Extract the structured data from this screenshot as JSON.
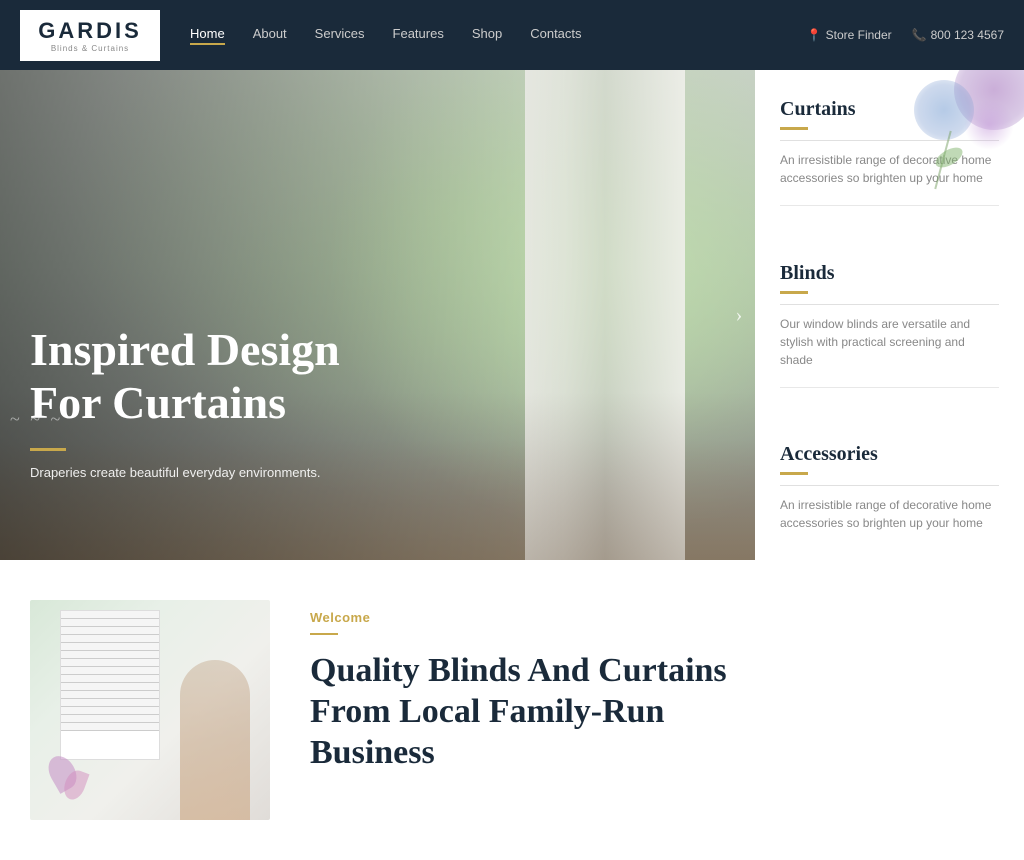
{
  "brand": {
    "name": "GARDIS",
    "subtitle": "Blinds & Curtains"
  },
  "navbar": {
    "links": [
      {
        "label": "Home",
        "active": true
      },
      {
        "label": "About",
        "active": false
      },
      {
        "label": "Services",
        "active": false
      },
      {
        "label": "Features",
        "active": false
      },
      {
        "label": "Shop",
        "active": false
      },
      {
        "label": "Contacts",
        "active": false
      }
    ],
    "store_finder": "Store Finder",
    "phone": "800 123 4567"
  },
  "hero": {
    "title": "Inspired Design\nFor Curtains",
    "subtitle": "Draperies create beautiful everyday environments.",
    "decorative_dots": "~~~"
  },
  "sidebar": {
    "categories": [
      {
        "title": "Curtains",
        "text": "An irresistible range of decorative home accessories so brighten up your home"
      },
      {
        "title": "Blinds",
        "text": "Our window blinds are versatile and stylish with practical screening and shade"
      },
      {
        "title": "Accessories",
        "text": "An irresistible range of decorative home accessories so brighten up your home"
      }
    ]
  },
  "bottom": {
    "welcome_label": "Welcome",
    "title_line1": "Quality Blinds And Curtains",
    "title_line2": "From Local Family-Run",
    "title_line3": "Business"
  }
}
